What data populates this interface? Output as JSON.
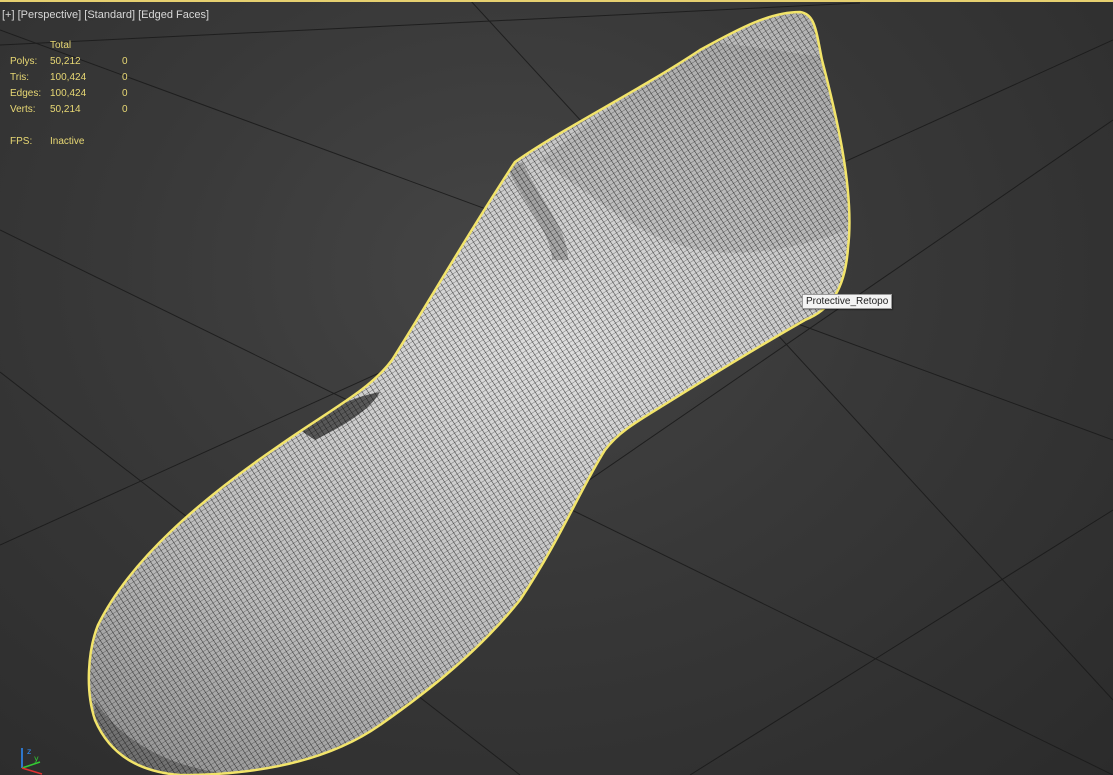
{
  "viewport": {
    "label_plus": "[+]",
    "label_view": "[Perspective]",
    "label_shading": "[Standard]",
    "label_mode": "[Edged Faces]",
    "border_color": "#e6d070"
  },
  "stats": {
    "header": "Total",
    "rows": [
      {
        "label": "Polys:",
        "total": "50,212",
        "selected": "0"
      },
      {
        "label": "Tris:",
        "total": "100,424",
        "selected": "0"
      },
      {
        "label": "Edges:",
        "total": "100,424",
        "selected": "0"
      },
      {
        "label": "Verts:",
        "total": "50,214",
        "selected": "0"
      }
    ],
    "fps_label": "FPS:",
    "fps_value": "Inactive",
    "text_color": "#e8d874"
  },
  "object": {
    "name": "Protective_Retopo",
    "selection_outline_color": "#f2e46a",
    "mesh_fill": "#bdbdbd",
    "wire_color": "#111111"
  },
  "gizmo": {
    "x_axis": "x",
    "y_axis": "y",
    "z_axis": "z"
  }
}
